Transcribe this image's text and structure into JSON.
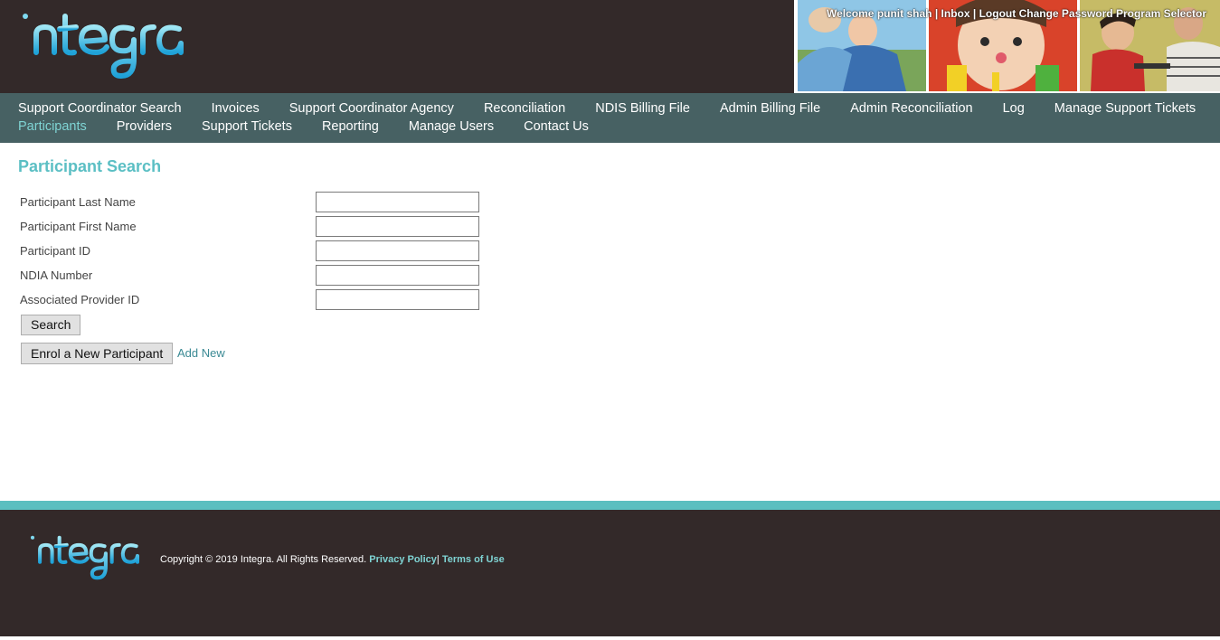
{
  "brand": {
    "logo_text": "integra"
  },
  "header": {
    "welcome": "Welcome punit shah",
    "inbox": "Inbox",
    "logout": "Logout",
    "change_password": "Change Password",
    "program_selector": "Program Selector",
    "separator": "|"
  },
  "nav": {
    "row1": [
      "Support Coordinator Search",
      "Invoices",
      "Support Coordinator Agency",
      "Reconciliation",
      "NDIS Billing File",
      "Admin Billing File",
      "Admin Reconciliation",
      "Log",
      "Manage Support Tickets"
    ],
    "row2": [
      "Participants",
      "Providers",
      "Support Tickets",
      "Reporting",
      "Manage Users",
      "Contact Us"
    ],
    "active": "Participants"
  },
  "main": {
    "title": "Participant Search",
    "fields": [
      {
        "label": "Participant Last Name",
        "value": "",
        "placeholder": ""
      },
      {
        "label": "Participant First Name",
        "value": "",
        "placeholder": ""
      },
      {
        "label": "Participant ID",
        "value": "",
        "placeholder": ""
      },
      {
        "label": "NDIA Number",
        "value": "",
        "placeholder": ""
      },
      {
        "label": "Associated Provider ID",
        "value": "",
        "placeholder": ""
      }
    ],
    "search_button": "Search",
    "enrol_button": "Enrol a New Participant",
    "add_new_link": "Add New"
  },
  "footer": {
    "copyright": "Copyright © 2019 Integra. All Rights Reserved.",
    "privacy_policy": "Privacy Policy",
    "separator": "|",
    "terms_of_use": "Terms of Use"
  },
  "colors": {
    "header_bg": "#332929",
    "nav_bg": "#476163",
    "accent": "#5bbfc4",
    "active_nav": "#7fd4d4",
    "link": "#3b8a94"
  },
  "icons": {
    "logo": "integra-ribbon-logo",
    "photos": [
      "man-with-child-photo",
      "child-painting-photo",
      "boy-with-carer-photo"
    ]
  }
}
